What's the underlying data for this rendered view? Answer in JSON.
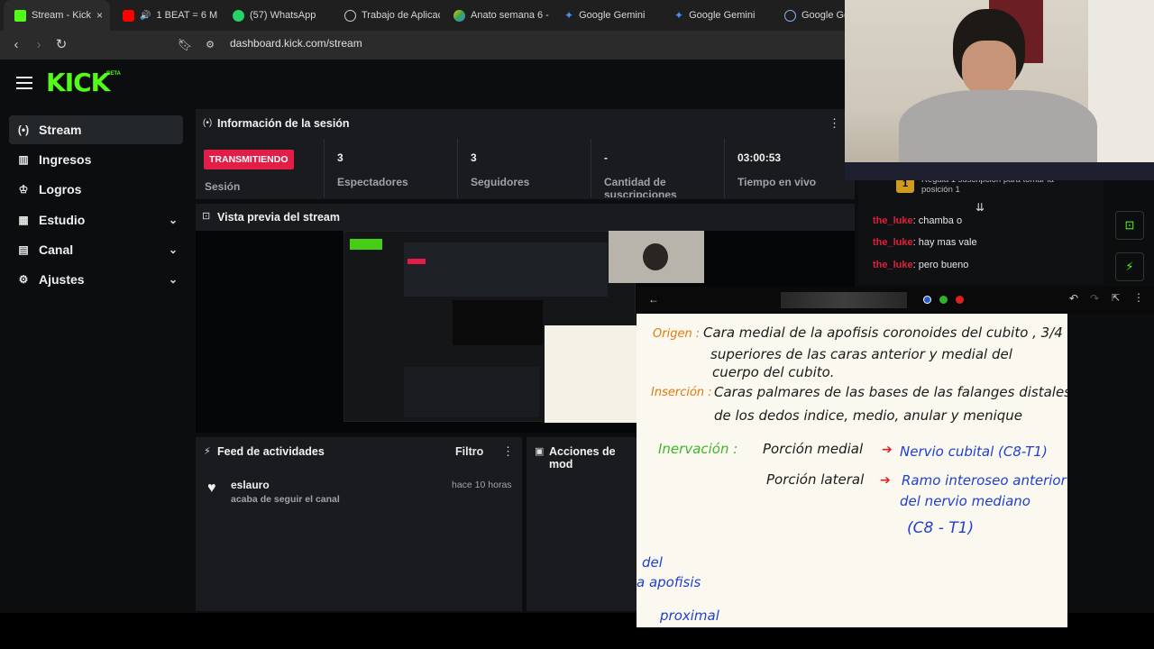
{
  "browser": {
    "tabs": [
      {
        "title": "Stream - Kick",
        "active": true,
        "close": "×"
      },
      {
        "title": "1 BEAT = 6 MI"
      },
      {
        "title": "(57) WhatsApp"
      },
      {
        "title": "Trabajo de Aplicac"
      },
      {
        "title": "Anato semana 6 -"
      },
      {
        "title": "Google Gemini"
      },
      {
        "title": "Google Gemini"
      },
      {
        "title": "Google Ge"
      }
    ],
    "url": "dashboard.kick.com/stream"
  },
  "brand": {
    "logo": "KICK",
    "beta": "BETA",
    "accent": "#53fc18"
  },
  "sidebar": {
    "items": [
      {
        "label": "Stream",
        "icon": "broadcast-icon"
      },
      {
        "label": "Ingresos",
        "icon": "bar-chart-icon"
      },
      {
        "label": "Logros",
        "icon": "trophy-icon"
      },
      {
        "label": "Estudio",
        "icon": "studio-icon"
      },
      {
        "label": "Canal",
        "icon": "channel-icon"
      },
      {
        "label": "Ajustes",
        "icon": "gear-icon"
      }
    ]
  },
  "session": {
    "title": "Información de la sesión",
    "status": "TRANSMITIENDO",
    "status_label": "Sesión",
    "viewers": "3",
    "viewers_label": "Espectadores",
    "followers": "3",
    "followers_label": "Seguidores",
    "subs": "-",
    "subs_label": "Cantidad de suscripciones",
    "live_time": "03:00:53",
    "live_time_label": "Tiempo en vivo"
  },
  "preview": {
    "title": "Vista previa del stream"
  },
  "feed": {
    "title": "Feed de actividades",
    "filter": "Filtro",
    "items": [
      {
        "user": "eslauro",
        "action": "acaba de seguir el canal",
        "time": "hace 10 horas"
      }
    ]
  },
  "mod": {
    "title": "Acciones de mod"
  },
  "chat": {
    "rank_text": "Regala 1 suscripción para tomar la posición 1",
    "rank": "1",
    "lines": [
      {
        "user": "the_luke",
        "text": ": chamba o"
      },
      {
        "user": "the_luke",
        "text": ": hay mas vale"
      },
      {
        "user": "the_luke",
        "text": ": pero bueno"
      }
    ]
  },
  "notes": {
    "origen_label": "Origen :",
    "origen_1": "Cara medial de la apofisis coronoides del cubito , 3/4",
    "origen_2": "superiores de las caras anterior y medial del",
    "origen_3": "cuerpo del cubito.",
    "insercion_label": "Inserción :",
    "insercion_1": "Caras palmares de las bases de las falanges distales",
    "insercion_2": "de los dedos indice, medio, anular y menique",
    "inervacion_label": "Inervación :",
    "medial": "Porción medial",
    "medial_nerve": "Nervio cubital (C8-T1)",
    "lateral": "Porción lateral",
    "lateral_nerve_1": "Ramo interoseo anterior",
    "lateral_nerve_2": "del nervio mediano",
    "lateral_nerve_3": "(C8 - T1)",
    "frag_1": "del",
    "frag_2": "a apofisis",
    "frag_3": "proximal"
  }
}
